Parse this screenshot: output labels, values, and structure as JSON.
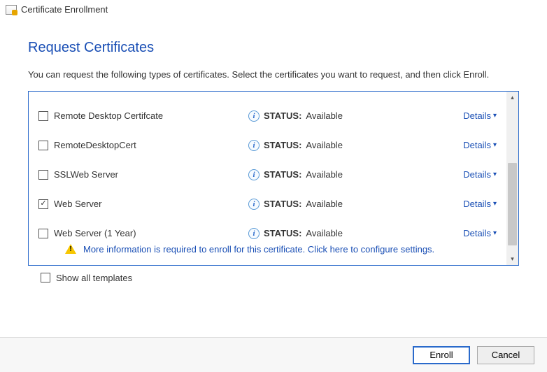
{
  "window": {
    "title": "Certificate Enrollment"
  },
  "page": {
    "heading": "Request Certificates",
    "description": "You can request the following types of certificates. Select the certificates you want to request, and then click Enroll."
  },
  "status_label": "STATUS:",
  "details_label": "Details",
  "certificates": [
    {
      "name": "Remote Desktop Certifcate",
      "checked": false,
      "status": "Available"
    },
    {
      "name": "RemoteDesktopCert",
      "checked": false,
      "status": "Available"
    },
    {
      "name": "SSLWeb Server",
      "checked": false,
      "status": "Available"
    },
    {
      "name": "Web Server",
      "checked": true,
      "status": "Available"
    },
    {
      "name": "Web Server (1 Year)",
      "checked": false,
      "status": "Available"
    }
  ],
  "warning": {
    "text": "More information is required to enroll for this certificate. Click here to configure settings."
  },
  "showall": {
    "label": "Show all templates",
    "checked": false
  },
  "buttons": {
    "enroll": "Enroll",
    "cancel": "Cancel"
  }
}
